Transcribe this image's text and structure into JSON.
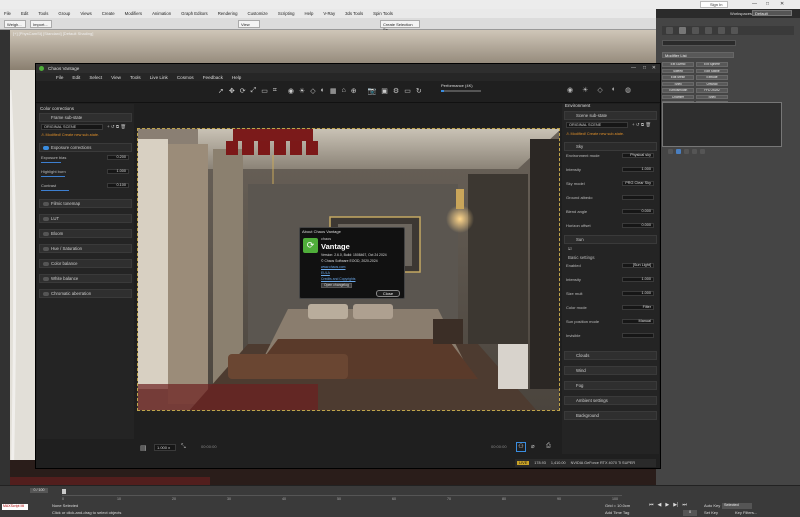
{
  "max": {
    "menu": [
      "File",
      "Edit",
      "Tools",
      "Group",
      "Views",
      "Create",
      "Modifiers",
      "Animation",
      "Graph Editors",
      "Rendering",
      "Customize",
      "Scripting",
      "Help",
      "V-Ray",
      "3ds Tools",
      "Spin Tools"
    ],
    "signin": "Sign In",
    "workspaces_label": "Workspaces:",
    "workspace": "Default",
    "create_selection_set": "Create Selection Se",
    "view_dropdown": "View",
    "viewport_label": "[+] [PhysCamSt] [Standard] [Default Shading]",
    "modifier_list": "Modifier List",
    "modifier_buttons": [
      "Ext Gizmo",
      "Ext Sphere",
      "Sweep",
      "Edit Spline",
      "Edit Mesh",
      "Extrude",
      "Shell",
      "Unwrap",
      "Turbosmooth",
      "FFD 2x2x2",
      "Chamfer",
      "Shell",
      "Normal",
      "Smooth",
      "Lathe"
    ],
    "status_none_selected": "None Selected",
    "status_hint": "Click or click-and-drag to select objects",
    "frame_counter": "0 / 100",
    "maxscript": "MAXScript Mi",
    "grid": "Grid = 10.0cm",
    "add_time_tag": "Add Time Tag",
    "autokey": "Auto Key",
    "setkey": "Set Key",
    "selected": "Selected",
    "key_filters": "Key Filters...",
    "frame_field": "0",
    "timeline_ticks": [
      "0",
      "10",
      "20",
      "30",
      "40",
      "50",
      "60",
      "70",
      "80",
      "90",
      "100"
    ]
  },
  "vantage": {
    "title": "Chaos Vantage",
    "menu": [
      "File",
      "Edit",
      "Select",
      "View",
      "Tools",
      "Live Link",
      "Cosmos",
      "Feedback",
      "Help"
    ],
    "performance_label": "Performance (4K)",
    "left": {
      "header": "Color corrections",
      "frame_sub_state": "Frame sub-state",
      "original_scene": "ORIGINAL SCENE",
      "modified_warning": "Modified! Create new sub-state.",
      "exposure_title": "Exposure corrections",
      "rows": [
        {
          "label": "Exposure bias",
          "value": "0.200"
        },
        {
          "label": "Highlight burn",
          "value": "1.000"
        },
        {
          "label": "Contrast",
          "value": "0.100"
        }
      ],
      "sections": [
        "Filmic tonemap",
        "LUT",
        "Bloom",
        "Hue / Saturation",
        "Color balance",
        "White balance",
        "Chromatic aberration"
      ]
    },
    "right": {
      "header": "Environment",
      "scene_sub_state": "Scene sub-state",
      "original_scene": "ORIGINAL SCENE",
      "modified_warning": "Modified! Create new sub-state.",
      "sky_title": "Sky",
      "sky_rows": [
        {
          "label": "Environment mode",
          "value": "Physical sky"
        },
        {
          "label": "Intensity",
          "value": "1.000"
        },
        {
          "label": "Sky model",
          "value": "PRG Clear Sky"
        },
        {
          "label": "Ground albedo",
          "value": ""
        },
        {
          "label": "Blend angle",
          "value": "0.000"
        },
        {
          "label": "Horizon offset",
          "value": "0.000"
        }
      ],
      "sun_title": "Sun",
      "sun_enabled": "Basic settings",
      "sun_rows": [
        {
          "label": "Enabled",
          "value": "[Sun Light]"
        },
        {
          "label": "Intensity",
          "value": "1.000"
        },
        {
          "label": "Size mult",
          "value": "1.000"
        },
        {
          "label": "Color mode",
          "value": "Filter"
        },
        {
          "label": "Sun position mode",
          "value": "Manual"
        },
        {
          "label": "Invisible",
          "value": ""
        }
      ],
      "sections": [
        "Clouds",
        "Wind",
        "Fog",
        "Ambient settings",
        "Background"
      ]
    },
    "bottom": {
      "zoom": "1.000 x",
      "time_left": "00:00:00",
      "time_right": "00:00:00",
      "status_badge": "LIVE",
      "fps": "178.93",
      "samples": "1,410.00",
      "gpu": "NVIDIA GeForce RTX 4070 Ti SUPER"
    },
    "about": {
      "title": "About Chaos Vantage",
      "brand_small": "chaos",
      "brand_big": "Vantage",
      "version": "Version: 2.6.0, Build: 1508467, Oct 24 2024",
      "copyright": "© Chaos Software EOOD, 2020-2024",
      "site": "www.chaos.com",
      "eula": "EULA",
      "credits": "Credits and Copyrights",
      "changelog_btn": "Open changelog",
      "close_btn": "Close"
    }
  },
  "colors": {
    "accent": "#3a8de0",
    "warning": "#e0902a",
    "brand_green": "#4fae3a",
    "live": "#c9a227"
  }
}
